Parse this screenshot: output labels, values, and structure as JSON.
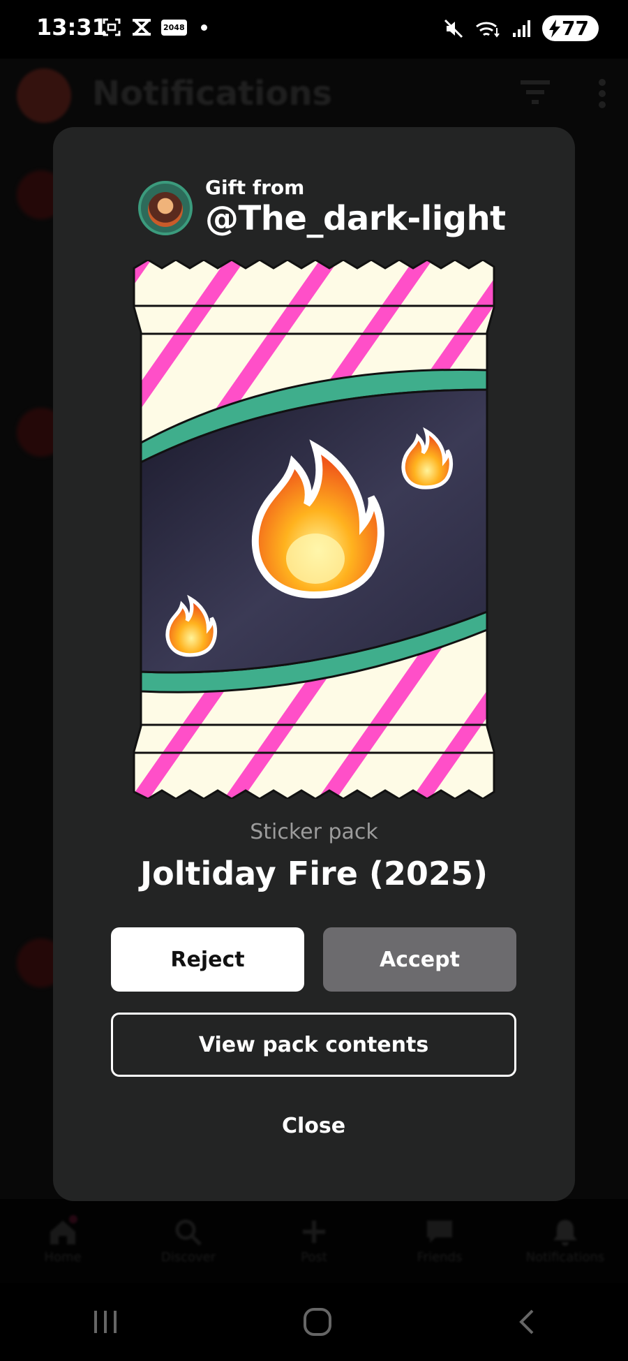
{
  "status_bar": {
    "time": "13:31",
    "badge": "2048",
    "battery": "77"
  },
  "background_app": {
    "title": "Notifications",
    "nav": [
      "Home",
      "Discover",
      "Post",
      "Friends",
      "Notifications"
    ]
  },
  "modal": {
    "gift_from_label": "Gift from",
    "giver_handle": "@The_dark-light",
    "pack_type": "Sticker pack",
    "pack_name": "Joltiday Fire (2025)",
    "reject_label": "Reject",
    "accept_label": "Accept",
    "view_contents_label": "View pack contents",
    "close_label": "Close"
  },
  "colors": {
    "modal_bg": "#232424",
    "accept_bg": "#6c6b6e",
    "stripe_pink": "#ff4fc8",
    "pack_cream": "#fefbe6",
    "band_teal": "#3fae8c"
  }
}
